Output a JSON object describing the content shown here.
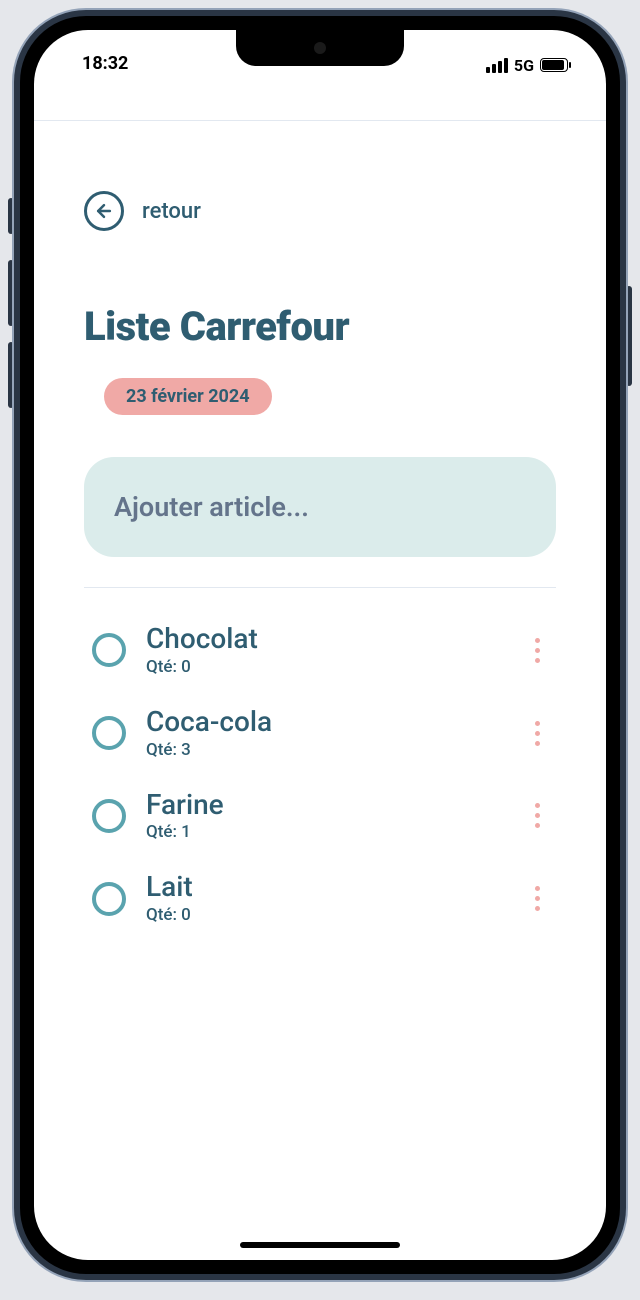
{
  "status": {
    "time": "18:32",
    "network": "5G"
  },
  "back": {
    "label": "retour"
  },
  "title": "Liste Carrefour",
  "date": "23 février 2024",
  "add": {
    "placeholder": "Ajouter article..."
  },
  "qty_prefix": "Qté: ",
  "items": [
    {
      "name": "Chocolat",
      "qty": "0"
    },
    {
      "name": "Coca-cola",
      "qty": "3"
    },
    {
      "name": "Farine",
      "qty": "1"
    },
    {
      "name": "Lait",
      "qty": "0"
    }
  ]
}
